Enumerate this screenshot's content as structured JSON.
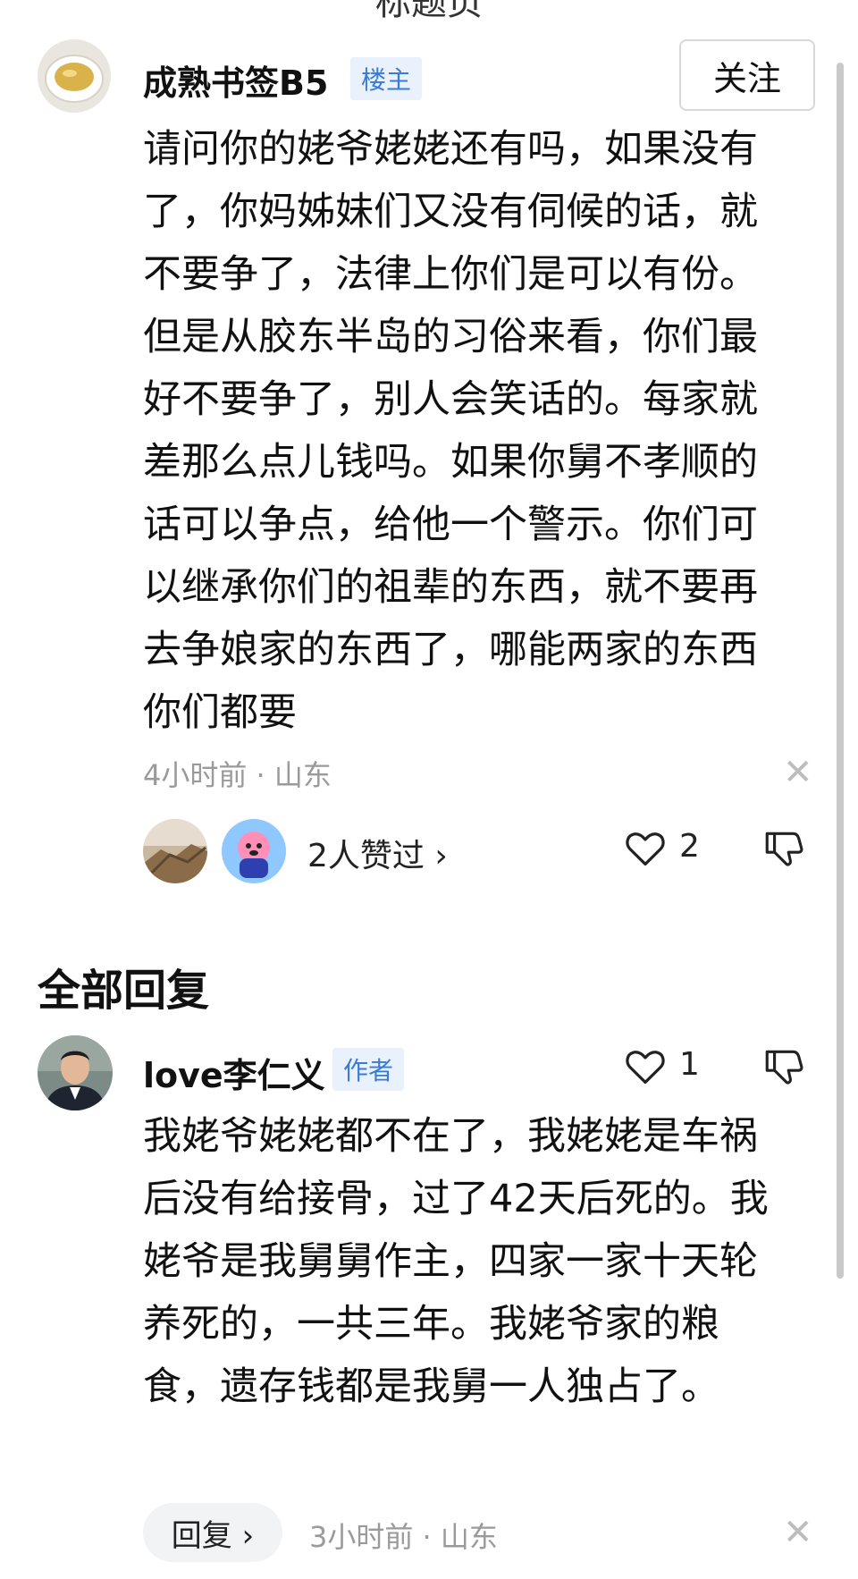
{
  "top_fragment": "标题页",
  "post": {
    "username": "成熟书签B5",
    "badge": "楼主",
    "follow_label": "关注",
    "text": "请问你的姥爷姥姥还有吗，如果没有了，你妈姊妹们又没有伺候的话，就不要争了，法律上你们是可以有份。但是从胶东半岛的习俗来看，你们最好不要争了，别人会笑话的。每家就差那么点儿钱吗。如果你舅不孝顺的话可以争点，给他一个警示。你们可以继承你们的祖辈的东西，就不要再去争娘家的东西了，哪能两家的东西你们都要",
    "time_location": "4小时前 · 山东",
    "liked_by_text": "2人赞过 ›",
    "like_count": "2",
    "icons": [
      "tea-cup-avatar",
      "like-heart-icon",
      "dislike-thumb-icon",
      "close-icon"
    ]
  },
  "section_title": "全部回复",
  "reply": {
    "username": "love李仁义",
    "badge": "作者",
    "like_count": "1",
    "text": "我姥爷姥姥都不在了，我姥姥是车祸后没有给接骨，过了42天后死的。我姥爷是我舅舅作主，四家一家十天轮养死的，一共三年。我姥爷家的粮食，遗存钱都是我舅一人独占了。",
    "reply_label": "回复 ›",
    "time_location": "3小时前 · 山东"
  },
  "colors": {
    "badge_blue": "#3a7bd5",
    "badge_bg": "#e9f1fc",
    "meta_gray": "#9a9a9a"
  }
}
